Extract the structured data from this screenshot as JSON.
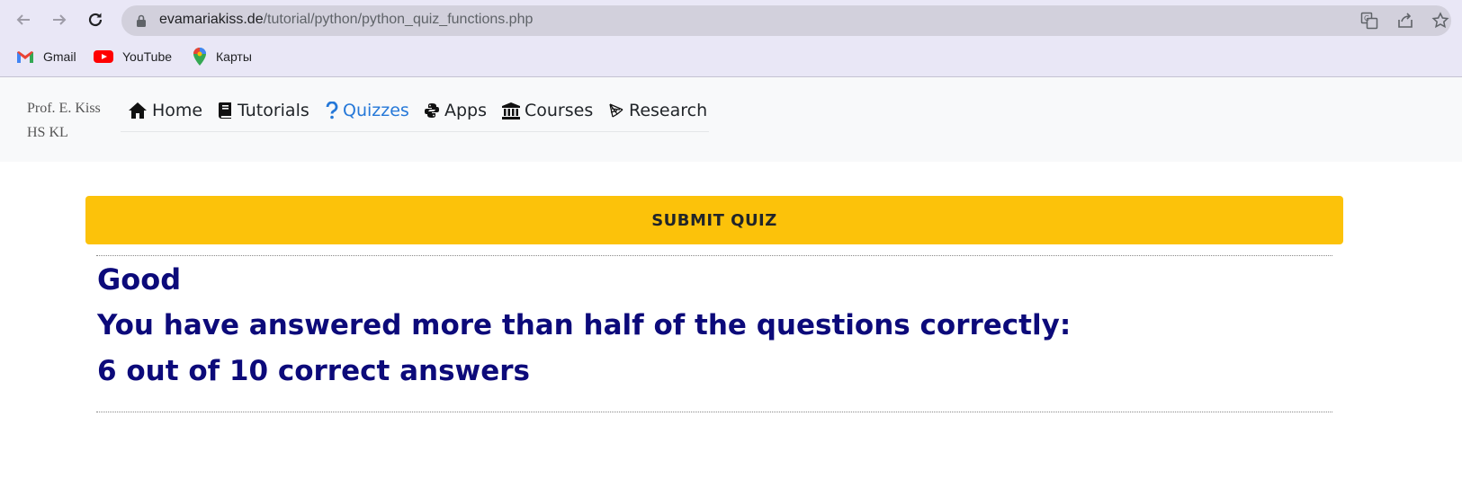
{
  "browser": {
    "url_host": "evamariakiss.de",
    "url_path": "/tutorial/python/python_quiz_functions.php",
    "bookmarks": [
      {
        "label": "Gmail",
        "icon": "gmail-icon"
      },
      {
        "label": "YouTube",
        "icon": "youtube-icon"
      },
      {
        "label": "Карты",
        "icon": "maps-icon"
      }
    ]
  },
  "site": {
    "brand_line1": "Prof. E. Kiss",
    "brand_line2": "HS KL",
    "nav": [
      {
        "label": "Home",
        "icon": "home-icon"
      },
      {
        "label": "Tutorials",
        "icon": "book-icon"
      },
      {
        "label": "Quizzes",
        "icon": "question-icon",
        "active": true
      },
      {
        "label": "Apps",
        "icon": "python-icon"
      },
      {
        "label": "Courses",
        "icon": "university-icon"
      },
      {
        "label": "Research",
        "icon": "research-icon"
      }
    ],
    "active_color": "#2578d8"
  },
  "quiz": {
    "submit_label": "SUBMIT QUIZ",
    "button_color": "#fcc20a",
    "result_title": "Good",
    "result_message": "You have answered more than half of the questions correctly:",
    "result_score": "6 out of 10 correct answers",
    "result_color": "#0c0a7a"
  }
}
